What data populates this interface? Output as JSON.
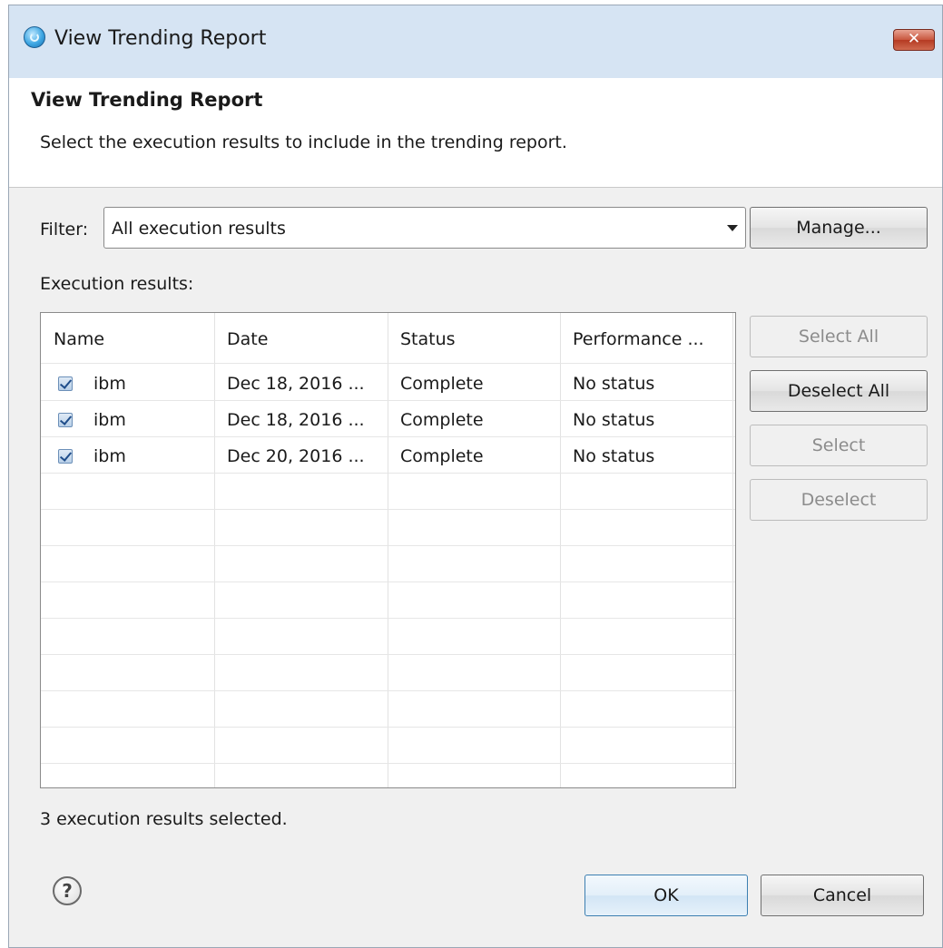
{
  "window": {
    "title": "View Trending Report",
    "close_label": "✕"
  },
  "header": {
    "title": "View Trending Report",
    "description": "Select the execution results to include in the trending report."
  },
  "filter": {
    "label": "Filter:",
    "selected": "All execution results",
    "manage_label": "Manage..."
  },
  "results": {
    "label": "Execution results:",
    "columns": [
      "Name",
      "Date",
      "Status",
      "Performance ..."
    ],
    "rows": [
      {
        "checked": true,
        "name": "ibm",
        "date": "Dec 18, 2016 ...",
        "status": "Complete",
        "performance": "No status"
      },
      {
        "checked": true,
        "name": "ibm",
        "date": "Dec 18, 2016 ...",
        "status": "Complete",
        "performance": "No status"
      },
      {
        "checked": true,
        "name": "ibm",
        "date": "Dec 20, 2016 ...",
        "status": "Complete",
        "performance": "No status"
      }
    ]
  },
  "side_buttons": {
    "select_all": "Select All",
    "deselect_all": "Deselect All",
    "select": "Select",
    "deselect": "Deselect"
  },
  "status_text": "3 execution results selected.",
  "footer": {
    "help_icon": "help-icon",
    "ok_label": "OK",
    "cancel_label": "Cancel"
  },
  "colors": {
    "titlebar": "#d6e4f3",
    "close_button": "#c8553d",
    "dialog_background": "#f0f0f0"
  }
}
